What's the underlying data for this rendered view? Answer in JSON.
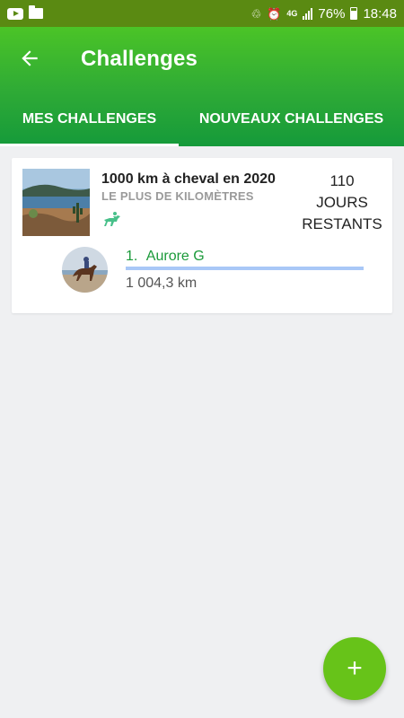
{
  "status_bar": {
    "battery": "76%",
    "time": "18:48",
    "network": "4G",
    "icons": [
      "youtube-icon",
      "folder-icon",
      "recycle-icon",
      "alarm-icon",
      "signal-icon",
      "battery-icon"
    ]
  },
  "app_bar": {
    "title": "Challenges",
    "back_icon": "arrow-left-icon",
    "background_color": "#2eaa36"
  },
  "tabs": [
    {
      "label": "MES CHALLENGES",
      "selected": true
    },
    {
      "label": "NOUVEAUX CHALLENGES",
      "selected": false
    }
  ],
  "challenge_card": {
    "name": "1000 km à cheval en 2020",
    "type": "LE PLUS DE KILOMÈTRES",
    "activity_icon": "horse-riding-icon",
    "days_number": "110",
    "days_label_1": "JOURS",
    "days_label_2": "RESTANTS",
    "leaderboard": [
      {
        "rank": "1.",
        "name": "Aurore G",
        "distance": "1 004,3 km",
        "progress": 1.0
      }
    ]
  },
  "fab": {
    "label": "+",
    "icon": "add-icon",
    "color": "#67c319"
  }
}
